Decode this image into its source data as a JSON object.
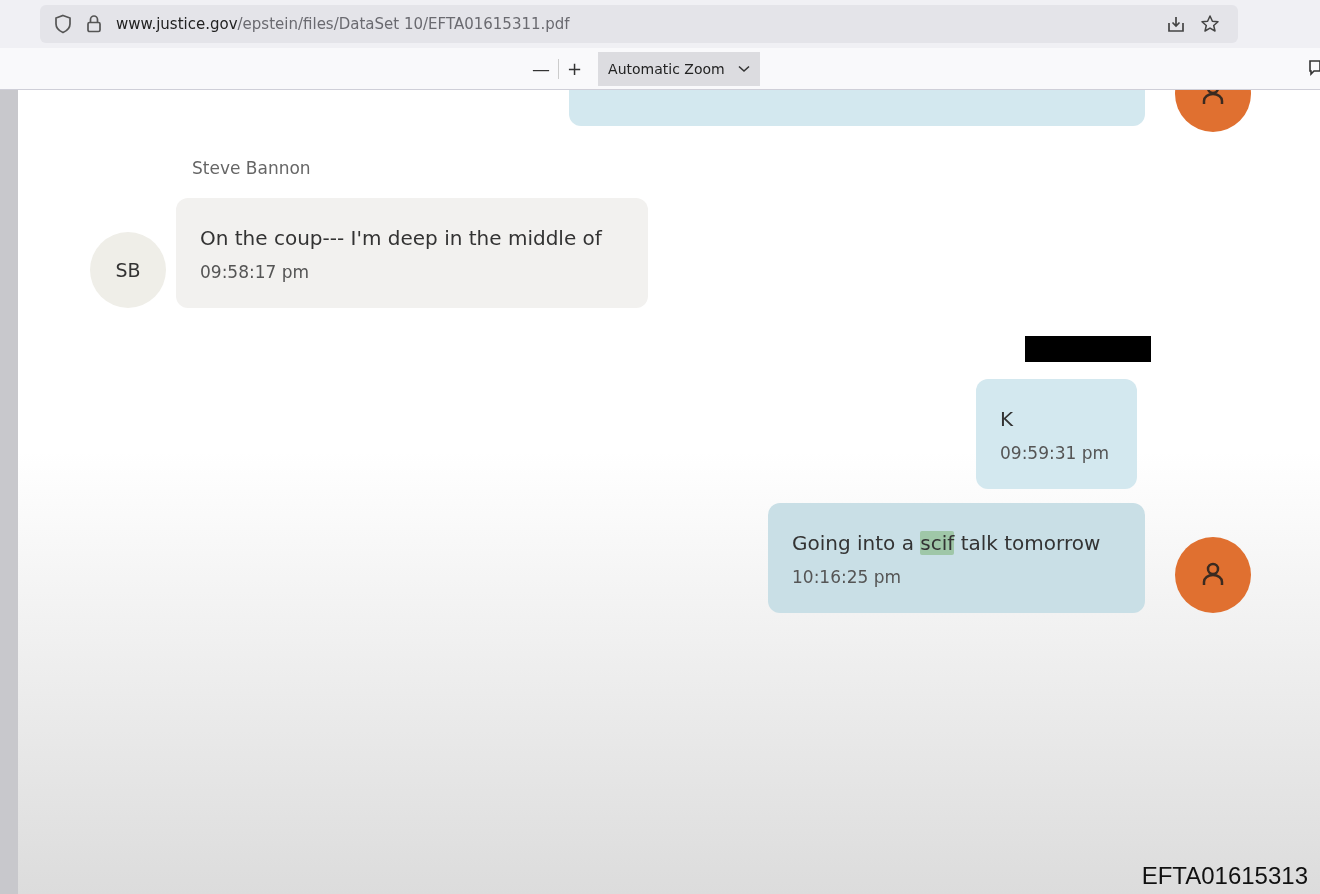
{
  "browser": {
    "url_host": "www.justice.gov",
    "url_path": "/epstein/files/DataSet 10/EFTA01615311.pdf"
  },
  "pdf_toolbar": {
    "zoom_out": "—",
    "zoom_in": "+",
    "zoom_select": "Automatic Zoom"
  },
  "messages": [
    {
      "kind": "outgoing",
      "sender_redacted": false,
      "has_avatar": true
    },
    {
      "kind": "incoming",
      "sender": "Steve Bannon",
      "sender_redacted": false,
      "has_avatar": true,
      "avatar_initials": "SB",
      "parts": [
        {
          "text": "On the coup--- I'm deep in the middle of",
          "highlighted": false
        }
      ],
      "time": "09:58:17 pm"
    },
    {
      "kind": "outgoing",
      "sender_redacted": true,
      "has_avatar": false,
      "parts": [
        {
          "text": "K",
          "highlighted": false
        }
      ],
      "time": "09:59:31 pm"
    },
    {
      "kind": "outgoing",
      "sender_redacted": false,
      "has_avatar": true,
      "parts": [
        {
          "text": "Going into a ",
          "highlighted": false
        },
        {
          "text": "scif",
          "highlighted": true
        },
        {
          "text": "  talk tomorrow",
          "highlighted": false
        }
      ],
      "time": "10:16:25 pm"
    }
  ],
  "page_footer": "EFTA01615313"
}
